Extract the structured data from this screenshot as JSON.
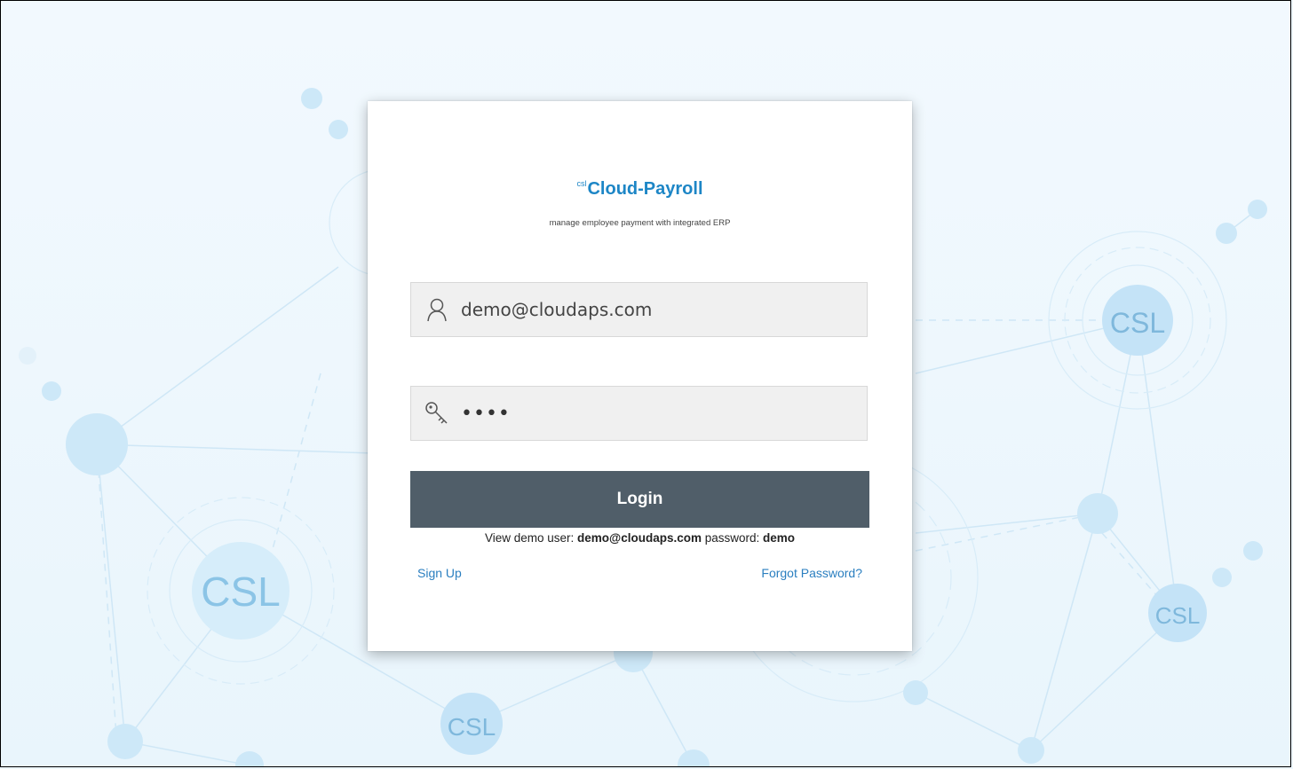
{
  "brand": {
    "logo_small": "csl",
    "title": "Cloud-Payroll",
    "tagline": "manage employee payment with integrated ERP",
    "color": "#1d86c6"
  },
  "login_form": {
    "username_value": "demo@cloudaps.com",
    "username_icon": "user-icon",
    "password_value": "demo",
    "password_icon": "key-icon",
    "login_label": "Login",
    "button_color": "#505e69",
    "demo_prefix": "View demo  user: ",
    "demo_user": "demo@cloudaps.com",
    "demo_mid": " password: ",
    "demo_password": "demo",
    "signup_label": "Sign Up",
    "forgot_label": "Forgot Password?"
  },
  "background": {
    "logo_text": "CSL"
  }
}
